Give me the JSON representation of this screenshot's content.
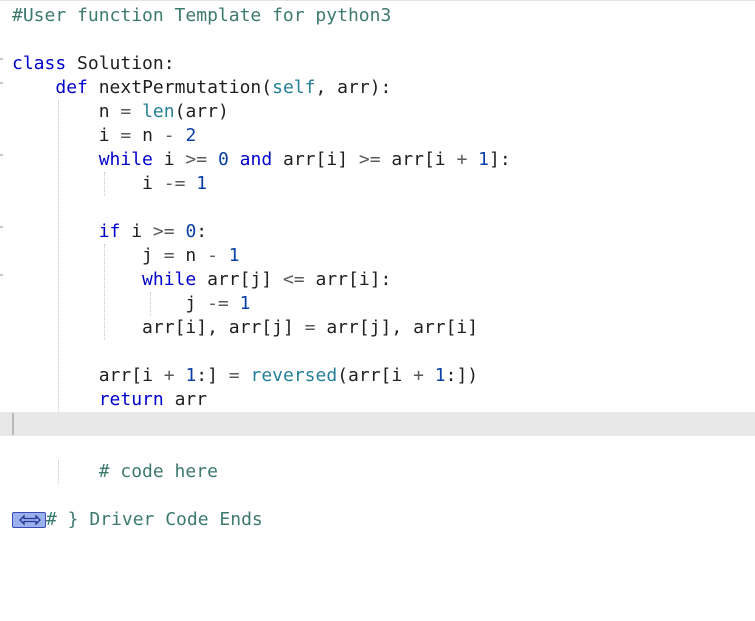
{
  "editor": {
    "lines": [
      {
        "id": "l1",
        "text": "#User function Template for python3"
      },
      {
        "id": "l2",
        "text": ""
      },
      {
        "id": "l3",
        "text": "class Solution:"
      },
      {
        "id": "l4",
        "text": "    def nextPermutation(self, arr):"
      },
      {
        "id": "l5",
        "text": "        n = len(arr)"
      },
      {
        "id": "l6",
        "text": "        i = n - 2"
      },
      {
        "id": "l7",
        "text": "        while i >= 0 and arr[i] >= arr[i + 1]:"
      },
      {
        "id": "l8",
        "text": "            i -= 1"
      },
      {
        "id": "l9",
        "text": ""
      },
      {
        "id": "l10",
        "text": "        if i >= 0:"
      },
      {
        "id": "l11",
        "text": "            j = n - 1"
      },
      {
        "id": "l12",
        "text": "            while arr[j] <= arr[i]:"
      },
      {
        "id": "l13",
        "text": "                j -= 1"
      },
      {
        "id": "l14",
        "text": "            arr[i], arr[j] = arr[j], arr[i]"
      },
      {
        "id": "l15",
        "text": ""
      },
      {
        "id": "l16",
        "text": "        arr[i + 1:] = reversed(arr[i + 1:])"
      },
      {
        "id": "l17",
        "text": "        return arr"
      },
      {
        "id": "l18",
        "text": ""
      },
      {
        "id": "l19",
        "text": ""
      },
      {
        "id": "l20",
        "text": "        # code here"
      },
      {
        "id": "l21",
        "text": ""
      },
      {
        "id": "l22",
        "text": "# } Driver Code Ends"
      }
    ],
    "folded_marker_icon": "fold-expand-icon",
    "colors": {
      "keyword": "#0000cc",
      "builtin": "#267f99",
      "number": "#0b3fa8",
      "comment": "#3d7a6e",
      "current_line": "#e8e8e8",
      "selection": "#b6d3f7"
    }
  }
}
